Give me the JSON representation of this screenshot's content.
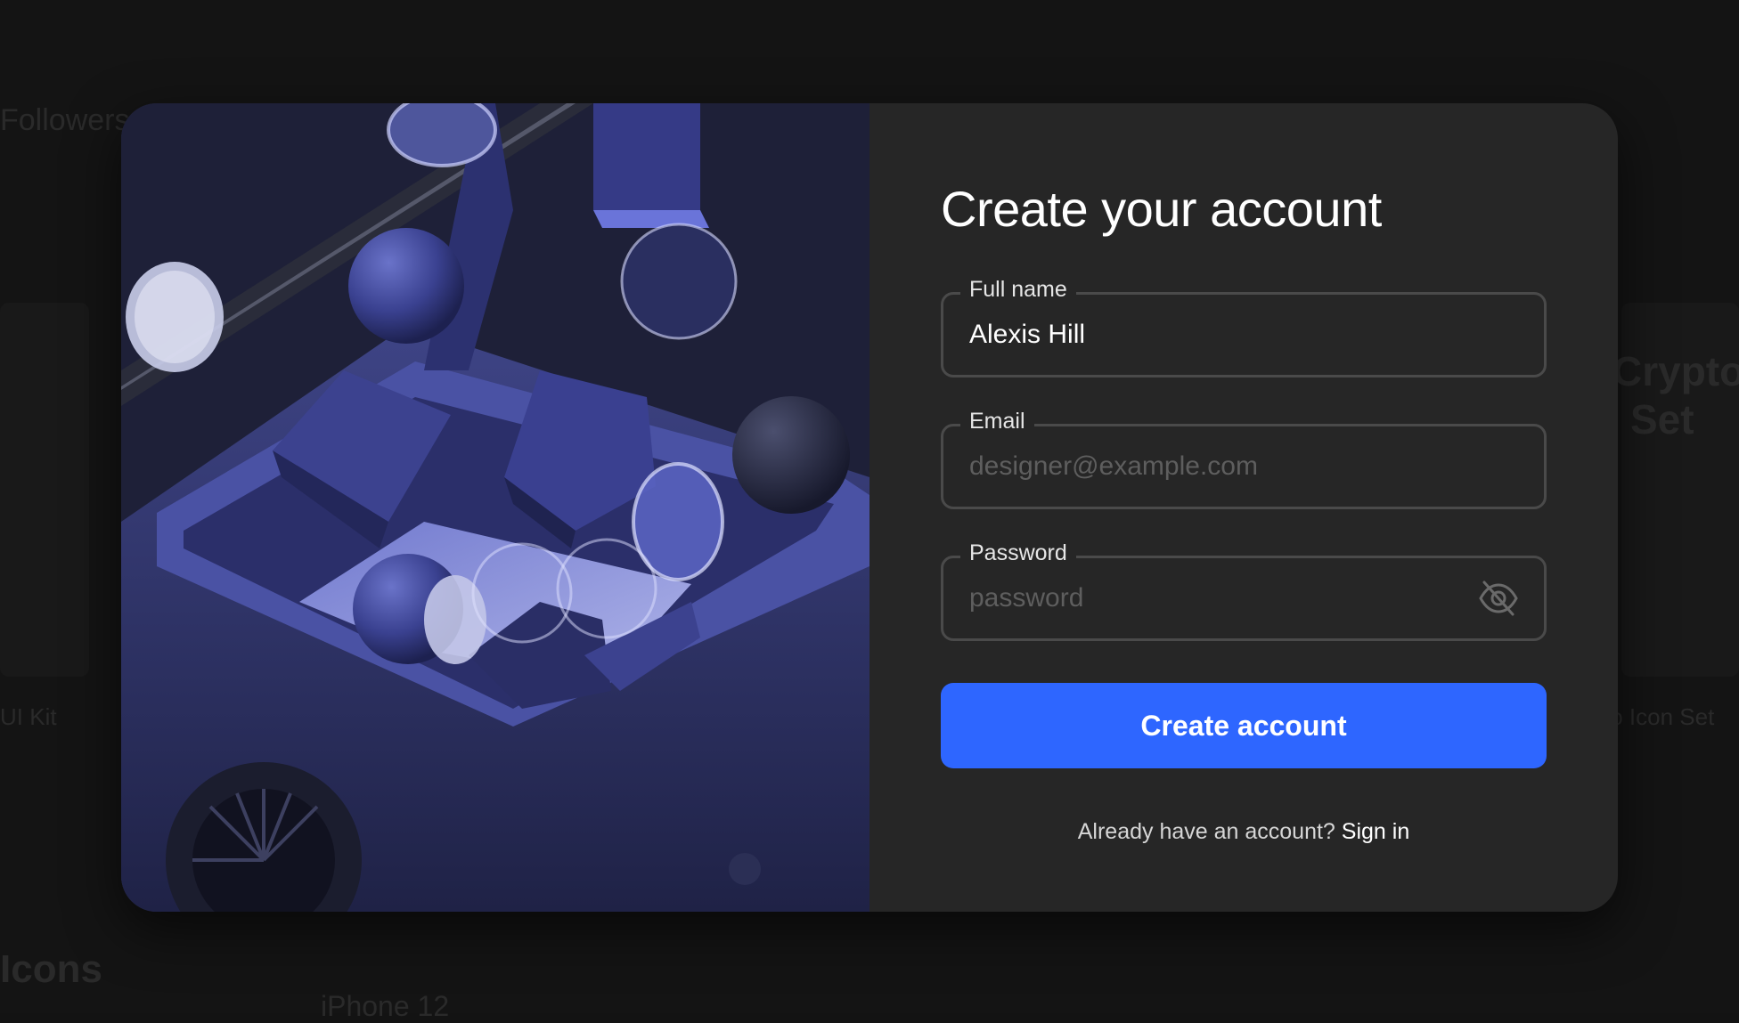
{
  "background": {
    "fragments": [
      "Followers",
      "Crypto",
      "Set",
      "UI Kit",
      "to Icon Set",
      "Icons",
      "iPhone 12"
    ]
  },
  "form": {
    "title": "Create your account",
    "full_name": {
      "label": "Full name",
      "value": "Alexis Hill",
      "placeholder": ""
    },
    "email": {
      "label": "Email",
      "value": "",
      "placeholder": "designer@example.com"
    },
    "password": {
      "label": "Password",
      "value": "",
      "placeholder": "password",
      "toggle_icon": "eye-off-icon"
    },
    "submit_label": "Create account",
    "signin_prompt": "Already have an account?",
    "signin_link": "Sign in"
  },
  "colors": {
    "accent": "#2e66ff",
    "panel": "#262626",
    "backdrop": "#141414",
    "art_bg": "#20223a"
  }
}
